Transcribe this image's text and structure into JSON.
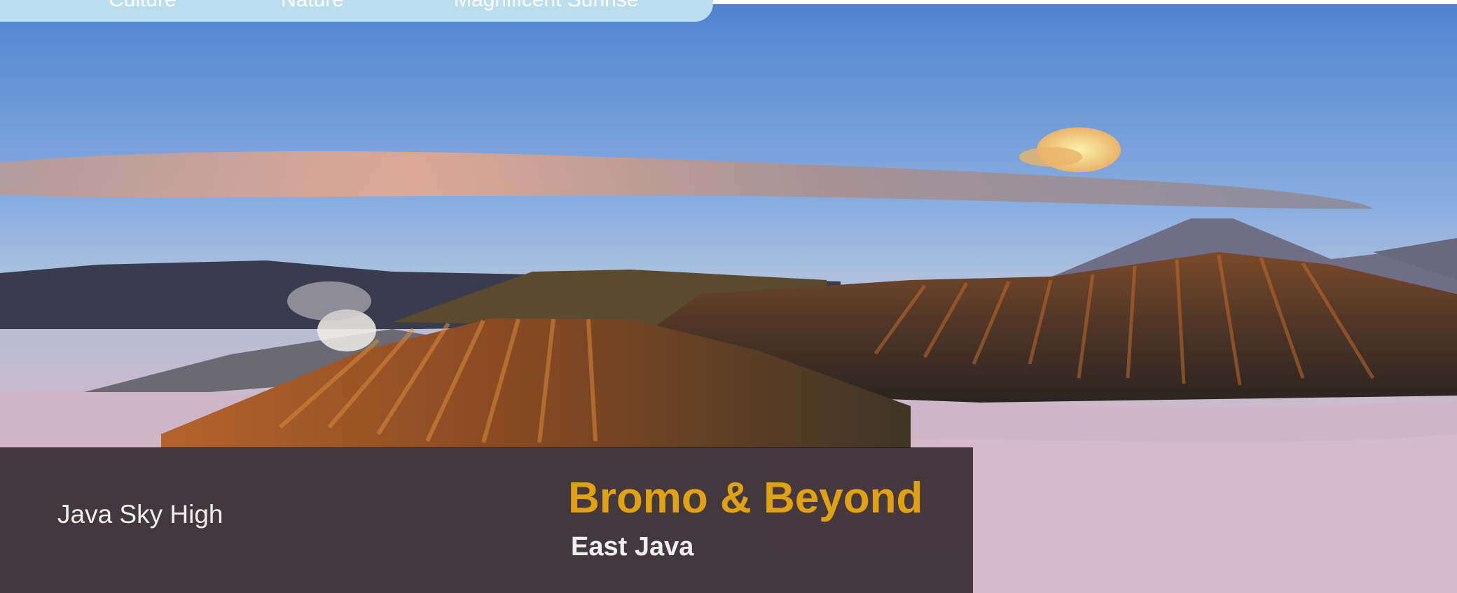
{
  "nav": {
    "items": [
      {
        "label": "Culture"
      },
      {
        "label": "Nature"
      },
      {
        "label": "Magnificent Sunrise"
      }
    ]
  },
  "caption": {
    "left_text": "Java Sky High",
    "title": "Bromo & Beyond",
    "subtitle": "East Java"
  },
  "colors": {
    "nav_background": "#bcdff0",
    "title": "#e0a112",
    "panel": "#1c1418"
  },
  "image": {
    "subject": "volcanic landscape at sunrise above sea of clouds"
  }
}
